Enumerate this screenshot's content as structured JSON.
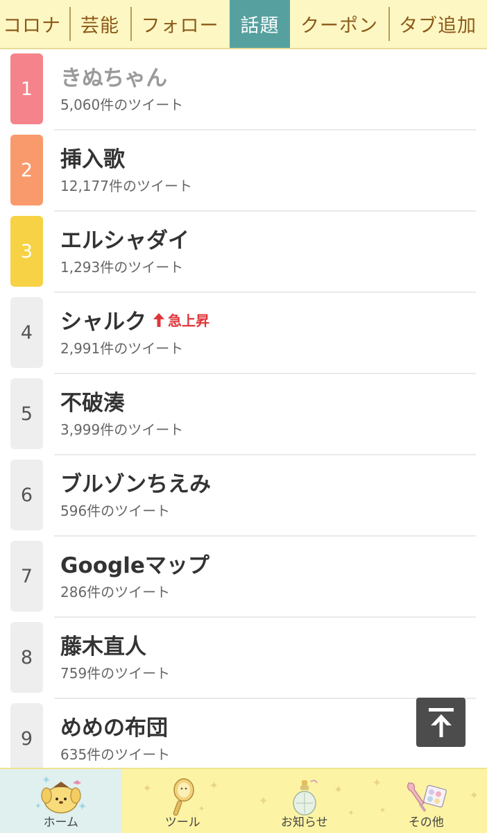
{
  "tabs": [
    {
      "label": "コロナ",
      "active": false
    },
    {
      "label": "芸能",
      "active": false
    },
    {
      "label": "フォロー",
      "active": false
    },
    {
      "label": "話題",
      "active": true
    },
    {
      "label": "クーポン",
      "active": false
    },
    {
      "label": "タブ追加",
      "active": false
    }
  ],
  "trends": [
    {
      "rank": "1",
      "title": "きぬちゃん",
      "count": "5,060件のツイート"
    },
    {
      "rank": "2",
      "title": "挿入歌",
      "count": "12,177件のツイート"
    },
    {
      "rank": "3",
      "title": "エルシャダイ",
      "count": "1,293件のツイート"
    },
    {
      "rank": "4",
      "title": "シャルク",
      "count": "2,991件のツイート",
      "badge": "急上昇"
    },
    {
      "rank": "5",
      "title": "不破湊",
      "count": "3,999件のツイート"
    },
    {
      "rank": "6",
      "title": "ブルゾンちえみ",
      "count": "596件のツイート"
    },
    {
      "rank": "7",
      "title": "Googleマップ",
      "count": "286件のツイート"
    },
    {
      "rank": "8",
      "title": "藤木直人",
      "count": "759件のツイート"
    },
    {
      "rank": "9",
      "title": "めめの布団",
      "count": "635件のツイート"
    }
  ],
  "scroll_top": {
    "icon": "arrow-up-to-top-icon"
  },
  "bottom_nav": [
    {
      "label": "ホーム",
      "icon": "pompompurin-icon",
      "active": true
    },
    {
      "label": "ツール",
      "icon": "hand-mirror-icon",
      "active": false
    },
    {
      "label": "お知らせ",
      "icon": "perfume-bottle-icon",
      "active": false
    },
    {
      "label": "その他",
      "icon": "makeup-brush-palette-icon",
      "active": false
    }
  ],
  "colors": {
    "tab_bar_bg": "#fdf7c4",
    "tab_text": "#8a5a18",
    "tab_active_bg": "#56a09f",
    "rank1": "#f5838b",
    "rank2": "#f99a6c",
    "rank3": "#f6d244",
    "rank_default": "#eeeeee",
    "rising_badge": "#e0353a",
    "bottom_nav_bg": "#fcf3a4",
    "bottom_nav_active_bg": "#dff0ee"
  }
}
